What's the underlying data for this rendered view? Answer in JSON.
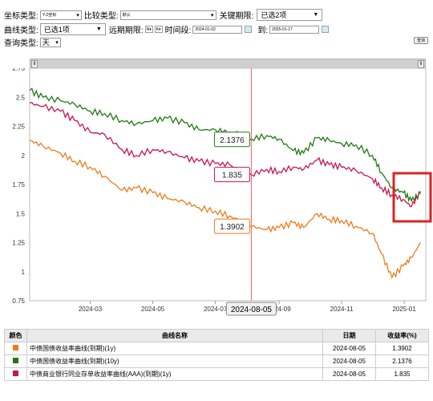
{
  "controls": {
    "coord_label": "坐标类型:",
    "coord_value": "Y-Z坐标",
    "compare_label": "比较类型:",
    "compare_value": "默认",
    "key_term_label": "关键期限:",
    "key_term_value": "已选2项",
    "curve_type_label": "曲线类型:",
    "curve_type_value": "已选1项",
    "forward_label": "远期期限:",
    "forward_n": "N",
    "forward_k": "K",
    "period_label": "时间段:",
    "start_date": "2024-01-02",
    "to_label": "到:",
    "end_date": "2025-01-17",
    "query_type_label": "查询类型:",
    "query_type_value": "天",
    "query_button": "查询"
  },
  "chart_data": {
    "type": "line",
    "ylim": [
      0.75,
      2.75
    ],
    "y_ticks": [
      "2.75",
      "2.5",
      "2.25",
      "2",
      "1.75",
      "1.5",
      "1.25",
      "1",
      "0.75"
    ],
    "x_ticks": [
      "2024-03",
      "2024-05",
      "2024-07",
      "2024-09",
      "2024-11",
      "2025-01"
    ],
    "crosshair_label": "2024-08-05",
    "tooltips": [
      "2.1376",
      "1.835",
      "1.3902"
    ],
    "series": [
      {
        "name": "中债国债收益率曲线(到期)(1y)",
        "color": "#f07a18",
        "points": [
          [
            "2024-01-02",
            2.13
          ],
          [
            "2024-01-15",
            2.08
          ],
          [
            "2024-02-01",
            2.02
          ],
          [
            "2024-02-15",
            1.95
          ],
          [
            "2024-03-01",
            1.9
          ],
          [
            "2024-03-15",
            1.82
          ],
          [
            "2024-04-01",
            1.7
          ],
          [
            "2024-04-15",
            1.72
          ],
          [
            "2024-05-01",
            1.68
          ],
          [
            "2024-05-15",
            1.63
          ],
          [
            "2024-06-01",
            1.6
          ],
          [
            "2024-06-15",
            1.55
          ],
          [
            "2024-07-01",
            1.52
          ],
          [
            "2024-07-15",
            1.48
          ],
          [
            "2024-08-05",
            1.39
          ],
          [
            "2024-08-20",
            1.36
          ],
          [
            "2024-09-01",
            1.38
          ],
          [
            "2024-09-15",
            1.42
          ],
          [
            "2024-09-25",
            1.38
          ],
          [
            "2024-10-08",
            1.5
          ],
          [
            "2024-10-20",
            1.45
          ],
          [
            "2024-11-01",
            1.44
          ],
          [
            "2024-11-15",
            1.39
          ],
          [
            "2024-12-01",
            1.33
          ],
          [
            "2024-12-10",
            1.15
          ],
          [
            "2024-12-20",
            0.95
          ],
          [
            "2024-12-31",
            1.05
          ],
          [
            "2025-01-08",
            1.12
          ],
          [
            "2025-01-17",
            1.25
          ]
        ]
      },
      {
        "name": "中债国债收益率曲线(到期)(10y)",
        "color": "#1f7a12",
        "points": [
          [
            "2024-01-02",
            2.56
          ],
          [
            "2024-01-15",
            2.5
          ],
          [
            "2024-02-01",
            2.47
          ],
          [
            "2024-02-15",
            2.44
          ],
          [
            "2024-03-01",
            2.38
          ],
          [
            "2024-03-15",
            2.36
          ],
          [
            "2024-04-01",
            2.3
          ],
          [
            "2024-04-15",
            2.27
          ],
          [
            "2024-05-01",
            2.3
          ],
          [
            "2024-05-15",
            2.32
          ],
          [
            "2024-06-01",
            2.28
          ],
          [
            "2024-06-15",
            2.22
          ],
          [
            "2024-07-01",
            2.22
          ],
          [
            "2024-07-15",
            2.2
          ],
          [
            "2024-08-05",
            2.14
          ],
          [
            "2024-08-20",
            2.17
          ],
          [
            "2024-09-01",
            2.14
          ],
          [
            "2024-09-15",
            2.04
          ],
          [
            "2024-09-25",
            2.02
          ],
          [
            "2024-10-08",
            2.15
          ],
          [
            "2024-10-20",
            2.13
          ],
          [
            "2024-11-01",
            2.1
          ],
          [
            "2024-11-15",
            2.09
          ],
          [
            "2024-12-01",
            2.0
          ],
          [
            "2024-12-10",
            1.85
          ],
          [
            "2024-12-20",
            1.72
          ],
          [
            "2024-12-31",
            1.68
          ],
          [
            "2025-01-08",
            1.61
          ],
          [
            "2025-01-17",
            1.67
          ]
        ]
      },
      {
        "name": "中债商业银行同业存单收益率曲线(AAA)(到期)(1y)",
        "color": "#c8154e",
        "points": [
          [
            "2024-01-02",
            2.45
          ],
          [
            "2024-01-15",
            2.42
          ],
          [
            "2024-02-01",
            2.38
          ],
          [
            "2024-02-15",
            2.3
          ],
          [
            "2024-03-01",
            2.2
          ],
          [
            "2024-03-15",
            2.18
          ],
          [
            "2024-04-01",
            2.05
          ],
          [
            "2024-04-15",
            2.0
          ],
          [
            "2024-05-01",
            2.05
          ],
          [
            "2024-05-15",
            2.03
          ],
          [
            "2024-06-01",
            1.98
          ],
          [
            "2024-06-15",
            1.95
          ],
          [
            "2024-07-01",
            1.93
          ],
          [
            "2024-07-15",
            1.92
          ],
          [
            "2024-08-05",
            1.835
          ],
          [
            "2024-08-20",
            1.88
          ],
          [
            "2024-09-01",
            1.86
          ],
          [
            "2024-09-15",
            1.9
          ],
          [
            "2024-09-25",
            1.88
          ],
          [
            "2024-10-08",
            1.96
          ],
          [
            "2024-10-20",
            1.92
          ],
          [
            "2024-11-01",
            1.9
          ],
          [
            "2024-11-15",
            1.87
          ],
          [
            "2024-12-01",
            1.8
          ],
          [
            "2024-12-10",
            1.72
          ],
          [
            "2024-12-20",
            1.66
          ],
          [
            "2024-12-31",
            1.62
          ],
          [
            "2025-01-08",
            1.56
          ],
          [
            "2025-01-17",
            1.69
          ]
        ]
      }
    ]
  },
  "legend": {
    "headers": [
      "颜色",
      "曲线名称",
      "日期",
      "收益率(%)"
    ],
    "rows": [
      {
        "color": "#f07a18",
        "name": "中债国债收益率曲线(到期)(1y)",
        "date": "2024-08-05",
        "value": "1.3902"
      },
      {
        "color": "#1f7a12",
        "name": "中债国债收益率曲线(到期)(10y)",
        "date": "2024-08-05",
        "value": "2.1376"
      },
      {
        "color": "#c8154e",
        "name": "中债商业银行同业存单收益率曲线(AAA)(到期)(1y)",
        "date": "2024-08-05",
        "value": "1.835"
      }
    ]
  }
}
